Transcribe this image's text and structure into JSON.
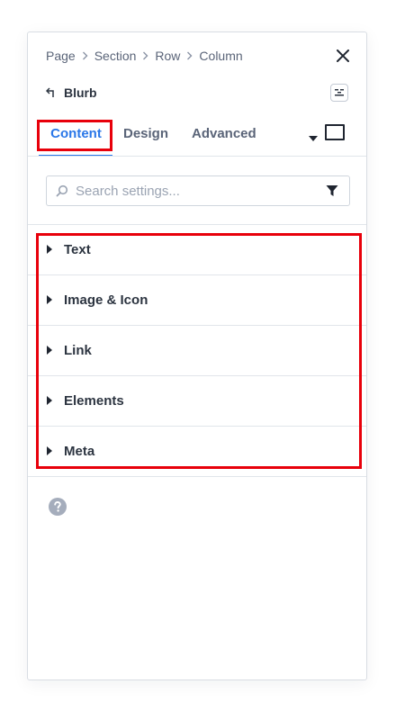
{
  "breadcrumb": {
    "items": [
      "Page",
      "Section",
      "Row",
      "Column"
    ]
  },
  "module": {
    "title": "Blurb"
  },
  "tabs": [
    {
      "label": "Content",
      "active": true
    },
    {
      "label": "Design",
      "active": false
    },
    {
      "label": "Advanced",
      "active": false
    }
  ],
  "search": {
    "placeholder": "Search settings...",
    "value": ""
  },
  "groups": [
    {
      "label": "Text"
    },
    {
      "label": "Image & Icon"
    },
    {
      "label": "Link"
    },
    {
      "label": "Elements"
    },
    {
      "label": "Meta"
    }
  ],
  "icons": {
    "close": "close-icon",
    "back": "back-arrow-icon",
    "preset": "preset-settings-icon",
    "dropdown": "caret-down-icon",
    "view_toggle": "view-mode-icon",
    "search": "search-icon",
    "filter": "filter-icon",
    "group_caret": "caret-right-icon",
    "help": "help-icon"
  },
  "colors": {
    "accent": "#2a77e8",
    "highlight": "#e8000b",
    "text": "#2c3440",
    "muted": "#5a6478"
  }
}
